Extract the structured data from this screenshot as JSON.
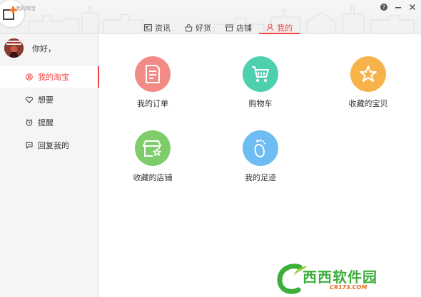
{
  "window": {
    "title": "我的淘宝"
  },
  "tabs": [
    {
      "label": "资讯",
      "icon": "news-icon"
    },
    {
      "label": "好货",
      "icon": "bag-icon"
    },
    {
      "label": "店铺",
      "icon": "shop-icon"
    },
    {
      "label": "我的",
      "icon": "user-icon",
      "active": true
    }
  ],
  "user": {
    "greeting": "你好，"
  },
  "sidebar": {
    "items": [
      {
        "label": "我的淘宝",
        "icon": "user-circle-icon",
        "active": true
      },
      {
        "label": "想要",
        "icon": "heart-icon"
      },
      {
        "label": "提醒",
        "icon": "alarm-icon"
      },
      {
        "label": "回复我的",
        "icon": "message-icon"
      }
    ]
  },
  "grid": {
    "items": [
      {
        "label": "我的订单",
        "icon": "order-icon",
        "color": "#f28b86"
      },
      {
        "label": "购物车",
        "icon": "cart-icon",
        "color": "#4ecfae"
      },
      {
        "label": "收藏的宝贝",
        "icon": "star-icon",
        "color": "#f7b24a"
      },
      {
        "label": "收藏的店铺",
        "icon": "store-star-icon",
        "color": "#7fcd6a"
      },
      {
        "label": "我的足迹",
        "icon": "footprint-icon",
        "color": "#6dbdf2"
      }
    ]
  },
  "colors": {
    "accent": "#f04343",
    "watermark": "#3dae3a"
  },
  "watermark": {
    "text": "西西软件园",
    "sub": "CR173.COM"
  }
}
